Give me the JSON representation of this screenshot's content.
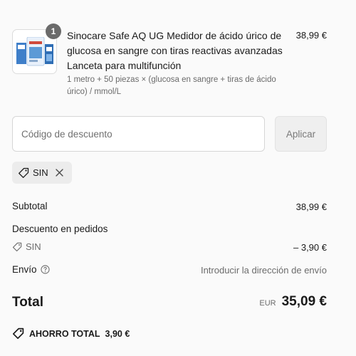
{
  "product": {
    "quantity": "1",
    "title": "Sinocare Safe AQ UG Medidor de ácido úrico de glucosa en sangre con tiras reactivas avanzadas Lanceta para multifunción",
    "variant": "1 metro + 50 piezas × (glucosa en sangre + tiras de ácido úrico) / mmol/L",
    "price": "38,99 €"
  },
  "discount": {
    "placeholder": "Código de descuento",
    "value": "",
    "apply_label": "Aplicar",
    "applied_code": "SIN"
  },
  "summary": {
    "subtotal_label": "Subtotal",
    "subtotal_value": "38,99 €",
    "order_discount_label": "Descuento en pedidos",
    "order_discount_code": "SIN",
    "order_discount_value": "– 3,90 €",
    "shipping_label": "Envío",
    "shipping_value": "Introducir la dirección de envío",
    "total_label": "Total",
    "total_currency": "EUR",
    "total_value": "35,09 €",
    "savings_label": "AHORRO TOTAL",
    "savings_value": "3,90 €"
  },
  "icons": {
    "tag": "tag-icon",
    "close": "close-icon",
    "help": "help-circle-icon"
  },
  "colors": {
    "background": "#fafafa",
    "text": "#1a1a1a",
    "muted": "#6b6b6b",
    "badge": "#6b6b6b",
    "chip": "#ececec",
    "button": "#efefef"
  }
}
